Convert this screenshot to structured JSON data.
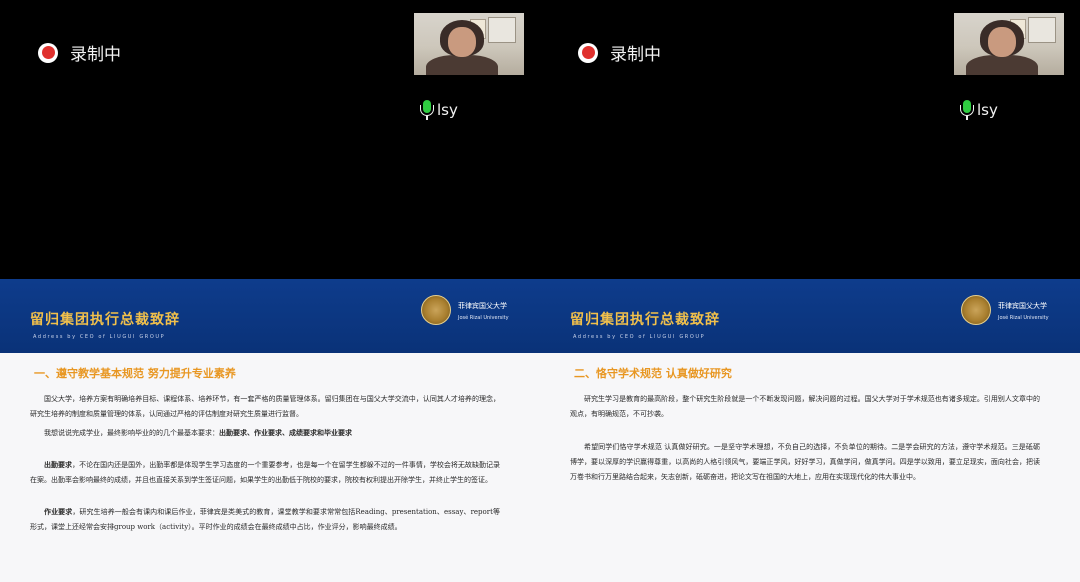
{
  "recording_label": "录制中",
  "speaker_name": "lsy",
  "colors": {
    "record_red": "#e0312e",
    "mic_green": "#2ecc40",
    "slide_blue": "#0e3c8c",
    "slide_gold": "#f1c04b",
    "heading_orange": "#e89723"
  },
  "icons": {
    "record": "record-dot-icon",
    "mic": "microphone-icon"
  },
  "left_slide": {
    "title": "留归集团执行总裁致辞",
    "subtitle": "Address by CEO of LIUGUI GROUP",
    "university_cn": "菲律宾国父大学",
    "university_en": "José Rizal University",
    "heading": "一、遵守教学基本规范 努力提升专业素养",
    "para1": "国父大学，培养方案有明确培养目标、课程体系、培养环节，有一套严格的质量管理体系。留归集团在与国父大学交流中，认同其人才培养的理念，研究生培养的制度和质量管理的体系，认同通过严格的评估制度对研究生质量进行监督。",
    "para2_text": "我想说说完成学业，最终影响毕业的的几个最基本要求：",
    "para2_bold": "出勤要求、作业要求、成绩要求和毕业要求",
    "para3_lead": "出勤要求",
    "para3_text": "，不论在国内还是国外，出勤率都是体现学生学习态度的一个重要参考，也是每一个在留学生都躲不过的一件事情，学校会将无故缺勤记录在案。出勤率会影响最终的成绩，并且也直接关系到学生签证问题，如果学生的出勤低于院校的要求，院校有权利提出开除学生，并终止学生的签证。",
    "para4_lead": "作业要求",
    "para4_text": "，研究生培养一般会有课内和课后作业，菲律宾是类美式的教育，课堂教学和要求常常包括Reading、presentation、essay、report等形式，课堂上还经常会安排group work（activity）。平时作业的成绩会在最终成绩中占比，作业评分，影响最终成绩。"
  },
  "right_slide": {
    "title": "留归集团执行总裁致辞",
    "subtitle": "Address by CEO of LIUGUI GROUP",
    "university_cn": "菲律宾国父大学",
    "university_en": "José Rizal University",
    "heading": "二、恪守学术规范 认真做好研究",
    "para1": "研究生学习是教育的最高阶段，整个研究生阶段就是一个不断发现问题，解决问题的过程。国父大学对于学术规范也有诸多规定。引用别人文章中的观点，有明确规范，不可抄袭。",
    "para2": "希望同学们恪守学术规范 认真做好研究。一是坚守学术理想，不负自己的选择，不负单位的期待。二是学会研究的方法，遵守学术规范。三是砥砺博学，要以深厚的学识赢得尊重，以高尚的人格引领风气，要端正学风，好好学习，真做学问，做真学问。四是学以致用，要立足现实，面向社会，把读万卷书和行万里路结合起来，矢志创新，砥砺奋进，把论文写在祖国的大地上，应用在实现现代化的伟大事业中。"
  }
}
